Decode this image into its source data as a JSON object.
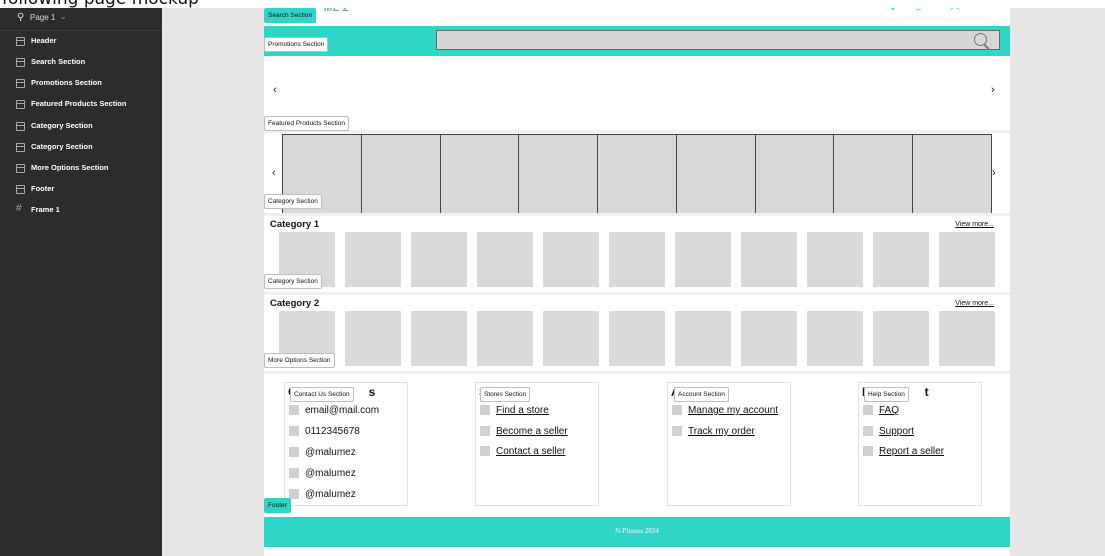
{
  "caption_partial": "following page mockup",
  "layers_panel": {
    "page_label": "Page 1",
    "layers": [
      {
        "label": "Header",
        "type": "section"
      },
      {
        "label": "Search Section",
        "type": "section"
      },
      {
        "label": "Promotions Section",
        "type": "section"
      },
      {
        "label": "Featured Products Section",
        "type": "section"
      },
      {
        "label": "Category Section",
        "type": "section"
      },
      {
        "label": "Category Section",
        "type": "section"
      },
      {
        "label": "More Options Section",
        "type": "section"
      },
      {
        "label": "Footer",
        "type": "section"
      },
      {
        "label": "Frame 1",
        "type": "frame"
      }
    ]
  },
  "header": {
    "logo_partial": "ME'Z",
    "icons": [
      "user-icon",
      "cart-icon",
      "menu-icon"
    ]
  },
  "section_tags": {
    "search": "Search Section",
    "promotions": "Promotions Section",
    "featured": "Featured Products Section",
    "category1": "Category Section",
    "category2": "Category Section",
    "more_options": "More Options Section",
    "contact": "Contact Us Section",
    "stores": "Stores Section",
    "account": "Account Section",
    "help": "Help Section",
    "footer": "Footer"
  },
  "promotions": {
    "prev": "‹",
    "next": "›"
  },
  "featured": {
    "prev": "‹",
    "next": "›",
    "product_count": 9
  },
  "categories": [
    {
      "title": "Category 1",
      "view_more": "View more...",
      "item_count": 11
    },
    {
      "title": "Category 2",
      "view_more": "View more...",
      "item_count": 11
    }
  ],
  "more_options": {
    "contact": {
      "heading_start": "C",
      "heading_end": "s",
      "items": [
        "email@mail.com",
        "0112345678",
        "@malumez",
        "@malumez",
        "@malumez"
      ]
    },
    "stores": {
      "heading_start": "S",
      "items": [
        "Find a store",
        "Become a seller",
        "Contact a seller"
      ]
    },
    "account": {
      "heading_start": "A",
      "items": [
        "Manage my account",
        "Track my order"
      ]
    },
    "help": {
      "heading_start": "H",
      "heading_end": "t",
      "items": [
        "FAQ",
        "Support",
        "Report a seller"
      ]
    }
  },
  "footer": {
    "text": "N-Plusses 2024"
  },
  "colors": {
    "accent": "#2ed6c8",
    "sidebar_bg": "#2c2c2c",
    "placeholder": "#d9d9d9"
  }
}
